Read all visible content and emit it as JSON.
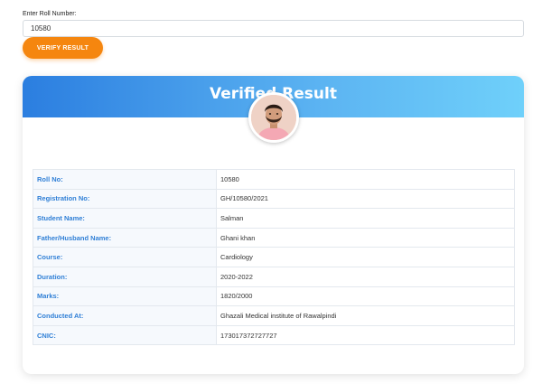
{
  "form": {
    "roll_label": "Enter Roll Number:",
    "roll_value": "10580",
    "verify_button": "VERIFY RESULT"
  },
  "result": {
    "title": "Verified Result",
    "rows": [
      {
        "label": "Roll No:",
        "value": "10580"
      },
      {
        "label": "Registration No:",
        "value": "GH/10580/2021"
      },
      {
        "label": "Student Name:",
        "value": "Salman"
      },
      {
        "label": "Father/Husband Name:",
        "value": "Ghani khan"
      },
      {
        "label": "Course:",
        "value": "Cardiology"
      },
      {
        "label": "Duration:",
        "value": "2020-2022"
      },
      {
        "label": "Marks:",
        "value": "1820/2000"
      },
      {
        "label": "Conducted At:",
        "value": "Ghazali Medical institute of Rawalpindi"
      },
      {
        "label": "CNIC:",
        "value": "173017372727727"
      }
    ]
  },
  "colors": {
    "accent_orange": "#f5860f",
    "header_gradient_start": "#2b7ee0",
    "header_gradient_end": "#6fd0fa",
    "label_blue": "#2f7fd6"
  },
  "icons": {
    "avatar": "student-photo"
  }
}
